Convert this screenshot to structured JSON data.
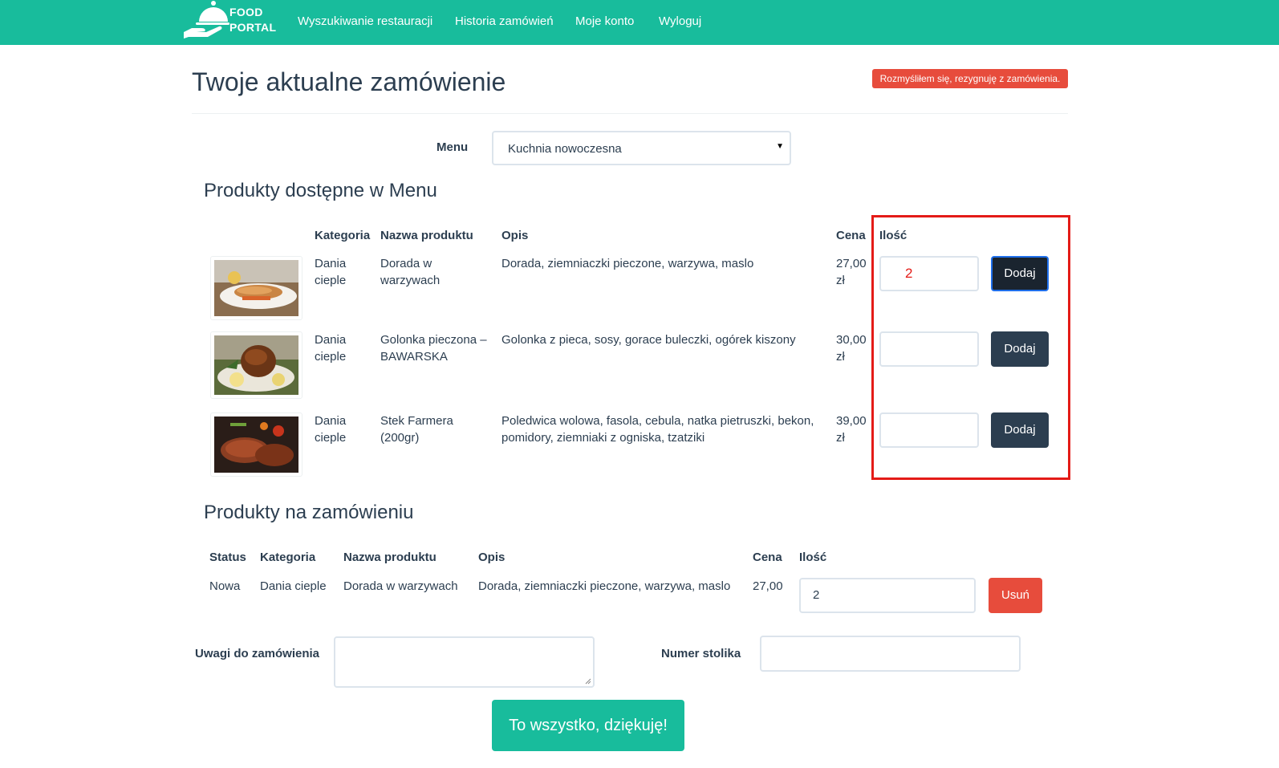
{
  "navbar": {
    "logo_line1": "FOOD",
    "logo_line2": "PORTAL",
    "links": [
      "Wyszukiwanie restauracji",
      "Historia zamówień",
      "Moje konto",
      "Wyloguj"
    ],
    "color": "#18bc9c"
  },
  "header": {
    "title": "Twoje aktualne zamówienie",
    "cancel_label": "Rozmyśliłem się, rezygnuję z zamówienia."
  },
  "menu": {
    "label": "Menu",
    "selected": "Kuchnia nowoczesna"
  },
  "available": {
    "title": "Produkty dostępne w Menu",
    "columns": [
      "Kategoria",
      "Nazwa produktu",
      "Opis",
      "Cena",
      "Ilość"
    ],
    "rows": [
      {
        "image": "fish-dish-image",
        "category_l1": "Dania",
        "category_l2": "cieple",
        "name_l1": "Dorada w",
        "name_l2": "warzywach",
        "description_l1": "Dorada, ziemniaczki pieczone, warzywa, maslo",
        "description_l2": "",
        "price_l1": "27,00",
        "price_l2": "zł",
        "quantity": "2",
        "button": "Dodaj"
      },
      {
        "image": "pork-knuckle-image",
        "category_l1": "Dania",
        "category_l2": "cieple",
        "name_l1": "Golonka pieczona –",
        "name_l2": "BAWARSKA",
        "description_l1": "Golonka z pieca, sosy, gorace buleczki, ogórek kiszony",
        "description_l2": "",
        "price_l1": "30,00",
        "price_l2": "zł",
        "quantity": "",
        "button": "Dodaj"
      },
      {
        "image": "steak-image",
        "category_l1": "Dania",
        "category_l2": "cieple",
        "name_l1": "Stek Farmera",
        "name_l2": "(200gr)",
        "description_l1": "Poledwica wolowa, fasola, cebula, natka pietruszki, bekon,",
        "description_l2": "pomidory, ziemniaki z ogniska, tzatziki",
        "price_l1": "39,00",
        "price_l2": "zł",
        "quantity": "",
        "button": "Dodaj"
      }
    ]
  },
  "order": {
    "title": "Produkty na zamówieniu",
    "columns": [
      "Status",
      "Kategoria",
      "Nazwa produktu",
      "Opis",
      "Cena",
      "Ilość"
    ],
    "rows": [
      {
        "status": "Nowa",
        "category": "Dania cieple",
        "name": "Dorada w warzywach",
        "description": "Dorada, ziemniaczki pieczone, warzywa, maslo",
        "price": "27,00",
        "quantity": "2",
        "button": "Usuń"
      }
    ]
  },
  "form": {
    "notes_label": "Uwagi do zamówienia",
    "notes_value": "",
    "table_label": "Numer stolika",
    "table_value": ""
  },
  "submit_label": "To wszystko, dziękuję!",
  "colors": {
    "primary": "#2c3e50",
    "success": "#18bc9c",
    "danger": "#e74c3c",
    "highlight": "#e41b17"
  }
}
